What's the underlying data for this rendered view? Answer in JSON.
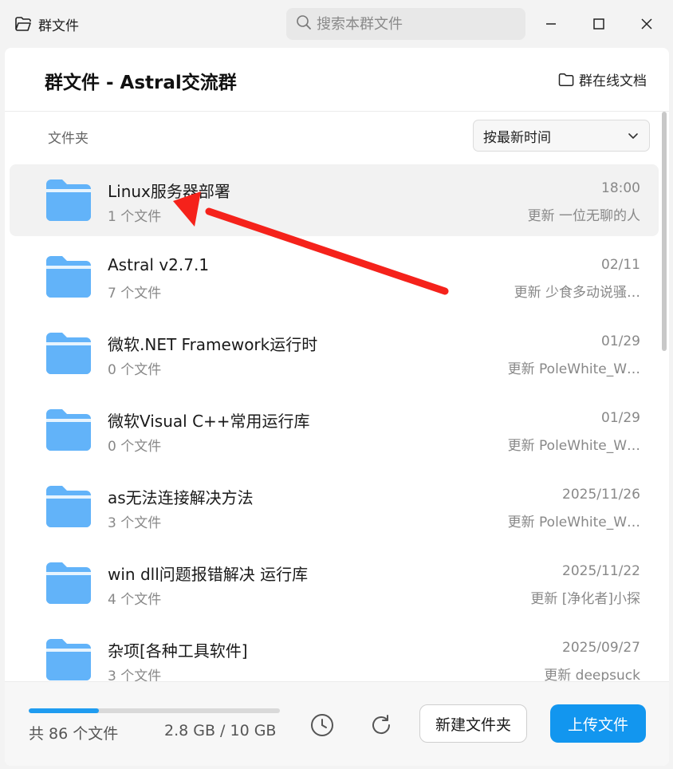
{
  "window": {
    "title": "群文件",
    "search_placeholder": "搜索本群文件"
  },
  "header": {
    "title": "群文件 - Astral交流群",
    "online_docs": "群在线文档"
  },
  "toolbar": {
    "folder_label": "文件夹",
    "sort_value": "按最新时间"
  },
  "folders": [
    {
      "name": "Linux服务器部署",
      "count": "1 个文件",
      "time": "18:00",
      "updater": "更新 一位无聊的人",
      "selected": true
    },
    {
      "name": "Astral v2.7.1",
      "count": "7 个文件",
      "time": "02/11",
      "updater": "更新 少食多动说骚…"
    },
    {
      "name": "微软.NET Framework运行时",
      "count": "0 个文件",
      "time": "01/29",
      "updater": "更新 PoleWhite_W…"
    },
    {
      "name": "微软Visual C++常用运行库",
      "count": "0 个文件",
      "time": "01/29",
      "updater": "更新 PoleWhite_W…"
    },
    {
      "name": "as无法连接解决方法",
      "count": "3 个文件",
      "time": "2025/11/26",
      "updater": "更新 PoleWhite_W…"
    },
    {
      "name": "win dll问题报错解决 运行库",
      "count": "4 个文件",
      "time": "2025/11/22",
      "updater": "更新 [净化者]小探"
    },
    {
      "name": "杂项[各种工具软件]",
      "count": "3 个文件",
      "time": "2025/09/27",
      "updater": "更新 deepsuck"
    }
  ],
  "footer": {
    "total": "共 86 个文件",
    "storage": "2.8 GB / 10 GB",
    "storage_used_fraction": 0.28,
    "new_folder": "新建文件夹",
    "upload": "上传文件"
  },
  "colors": {
    "accent": "#1296ef",
    "folder": "#62b3f9",
    "annotation_arrow": "#f5221b"
  }
}
